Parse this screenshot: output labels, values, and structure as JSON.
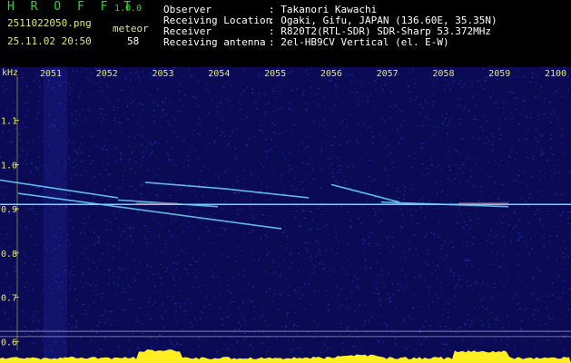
{
  "app": {
    "name": "H R O F F T",
    "version": "1.0.0",
    "file_name": "2511022050.png",
    "datetime": "25.11.02 20:50",
    "meteor_label": "meteor",
    "meteor_count": "58"
  },
  "station": {
    "rows": [
      {
        "label": "Observer",
        "value": ": Takanori Kawachi"
      },
      {
        "label": "Receiving Location",
        "value": ": Ogaki, Gifu, JAPAN (136.60E, 35.35N)"
      },
      {
        "label": "Receiver",
        "value": ": R820T2(RTL-SDR) SDR-Sharp 53.372MHz"
      },
      {
        "label": "Receiving antenna",
        "value": ": 2el-HB9CV Vertical (el. E-W)"
      }
    ]
  },
  "chart_data": {
    "type": "heatmap",
    "ylabel": "kHz",
    "x_ticks": [
      "2051",
      "2052",
      "2053",
      "2054",
      "2055",
      "2056",
      "2057",
      "2058",
      "2059",
      "2100"
    ],
    "y_ticks": [
      "1.1",
      "1.0",
      "0.9",
      "0.8",
      "0.7",
      "0.6"
    ],
    "ylim": [
      0.58,
      1.2
    ],
    "carrier_khz": 0.91,
    "reference_lines_khz": [
      0.623,
      0.611
    ],
    "colors": {
      "background": "#0a0a55",
      "noise": "#2a3cc8",
      "signal": "#6bd8ff",
      "hot": "#ff4040",
      "axis_text": "#e8e86a",
      "activity_bar": "#ffee22"
    }
  }
}
